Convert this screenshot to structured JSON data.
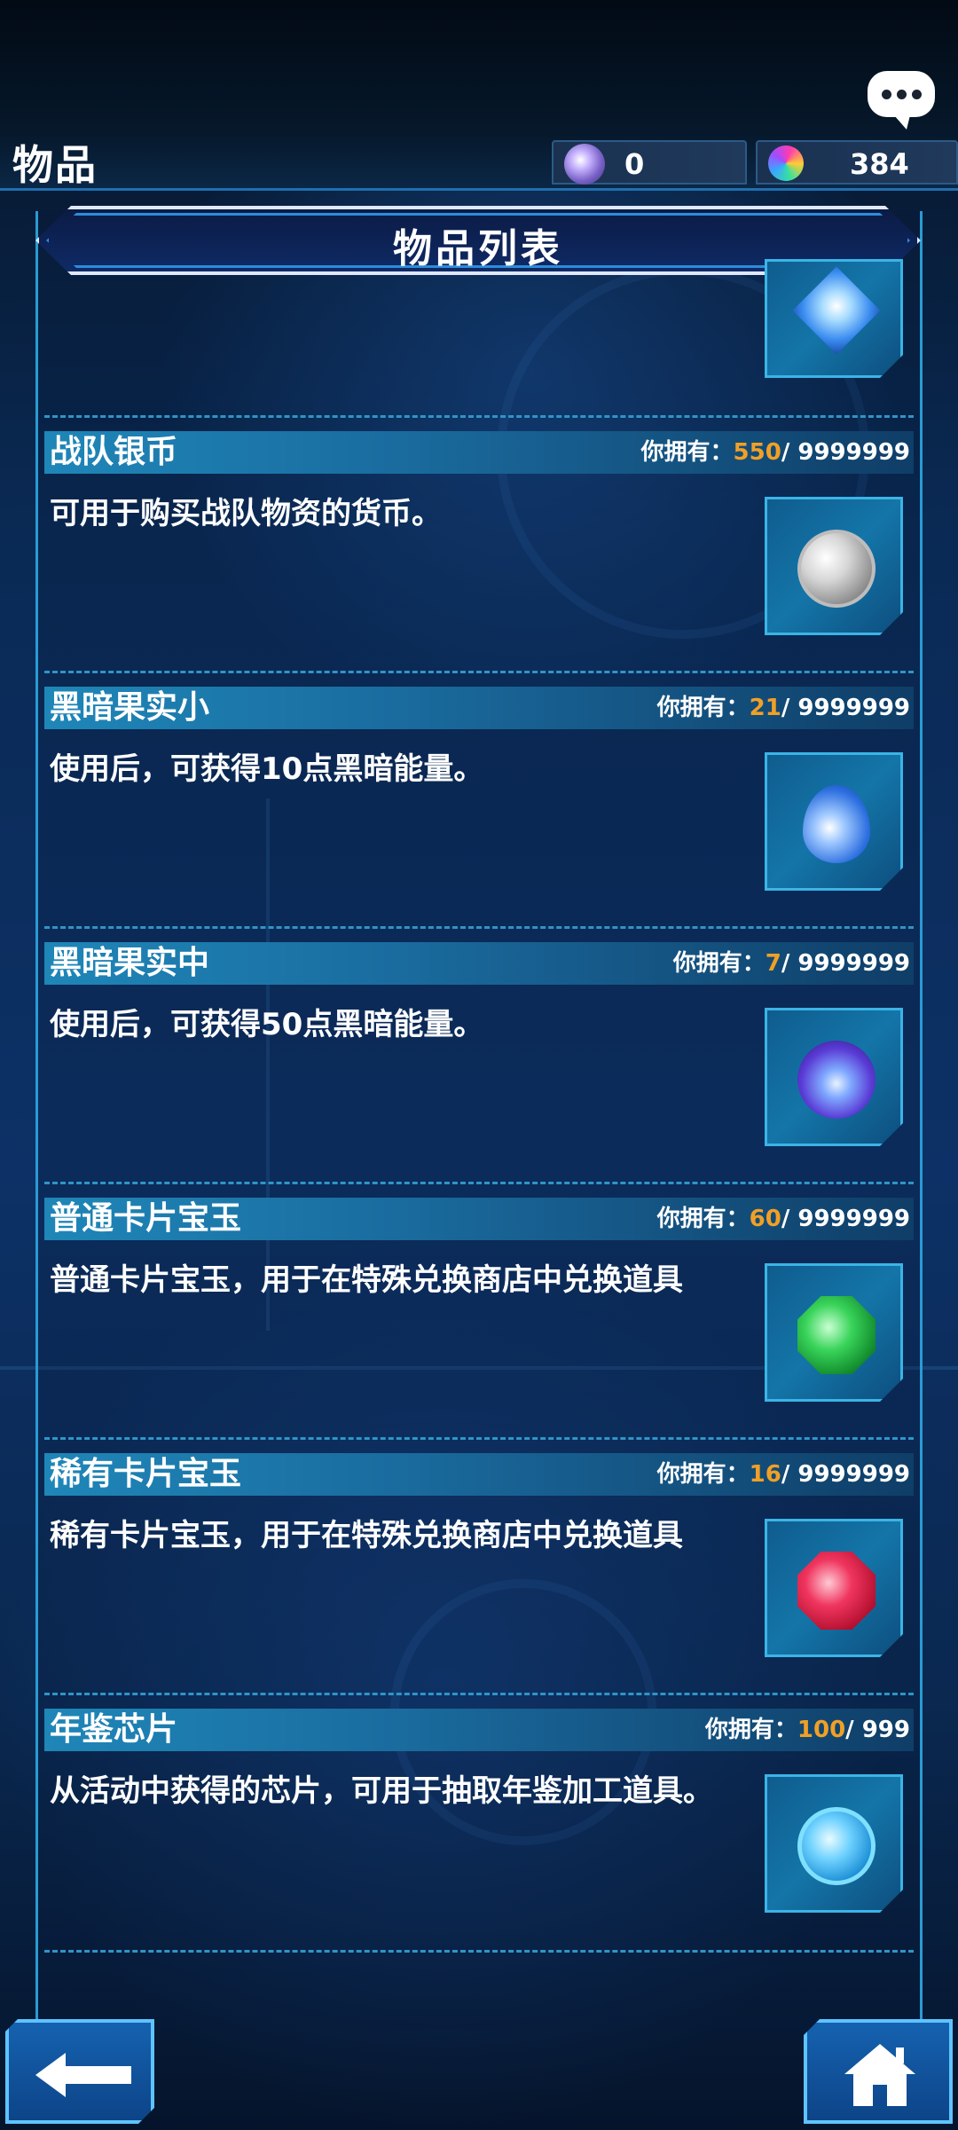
{
  "header": {
    "title": "物品",
    "currencies": [
      {
        "icon": "orb-icon",
        "value": "0"
      },
      {
        "icon": "gem-icon",
        "value": "384"
      }
    ]
  },
  "panel": {
    "title": "物品列表"
  },
  "items": [
    {
      "name": "战队银币",
      "owned_label": "你拥有：",
      "owned": "550",
      "max": "/ 9999999",
      "description": "可用于购买战队物资的货币。",
      "icon": "silver-coin-icon"
    },
    {
      "name": "黑暗果实小",
      "owned_label": "你拥有：",
      "owned": "21",
      "max": "/ 9999999",
      "description": "使用后，可获得10点黑暗能量。",
      "icon": "dark-fruit-small-icon"
    },
    {
      "name": "黑暗果实中",
      "owned_label": "你拥有：",
      "owned": "7",
      "max": "/ 9999999",
      "description": "使用后，可获得50点黑暗能量。",
      "icon": "dark-fruit-medium-icon"
    },
    {
      "name": "普通卡片宝玉",
      "owned_label": "你拥有：",
      "owned": "60",
      "max": "/ 9999999",
      "description": "普通卡片宝玉，用于在特殊兑换商店中兑换道具",
      "icon": "emerald-gem-icon"
    },
    {
      "name": "稀有卡片宝玉",
      "owned_label": "你拥有：",
      "owned": "16",
      "max": "/ 9999999",
      "description": "稀有卡片宝玉，用于在特殊兑换商店中兑换道具",
      "icon": "ruby-gem-icon"
    },
    {
      "name": "年鉴芯片",
      "owned_label": "你拥有：",
      "owned": "100",
      "max": "/ 999",
      "description": "从活动中获得的芯片，可用于抽取年鉴加工道具。",
      "icon": "almanac-chip-icon"
    }
  ],
  "nav": {
    "back_icon": "back-arrow-icon",
    "home_icon": "home-icon"
  }
}
